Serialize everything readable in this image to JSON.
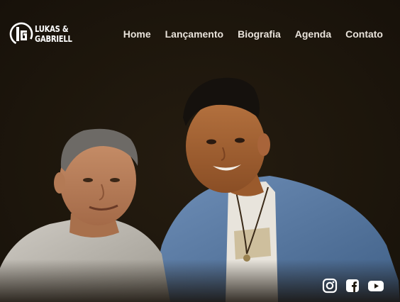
{
  "logo": {
    "line1": "LUKAS &",
    "line2": "GABRIELL",
    "icon": "lg-monogram-icon"
  },
  "nav": {
    "items": [
      {
        "label": "Home"
      },
      {
        "label": "Lançamento"
      },
      {
        "label": "Biografia"
      },
      {
        "label": "Agenda"
      },
      {
        "label": "Contato"
      }
    ]
  },
  "hero": {
    "image": "duo-portrait"
  },
  "social": {
    "icons": [
      "instagram-icon",
      "facebook-icon",
      "youtube-icon"
    ]
  },
  "colors": {
    "background": "#1e170d",
    "nav_text": "#e9e3db",
    "icon": "#ffffff"
  }
}
